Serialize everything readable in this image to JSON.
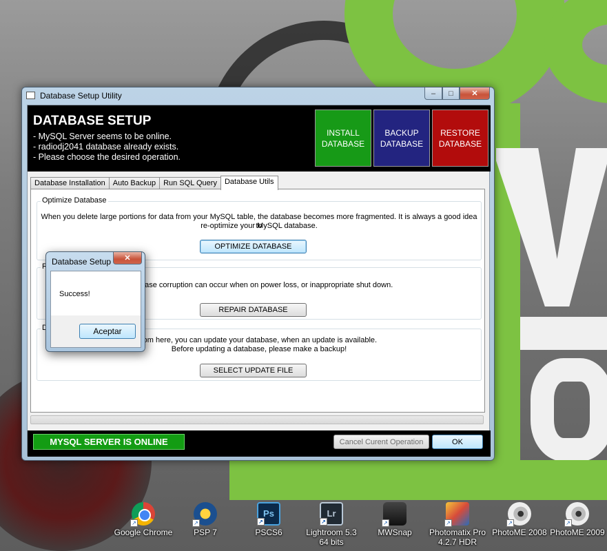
{
  "window": {
    "title": "Database Setup Utility",
    "caption_min": "–",
    "caption_max": "□",
    "caption_close": "✕"
  },
  "header": {
    "title": "DATABASE SETUP",
    "lines": [
      "- MySQL Server seems to be online.",
      "- radiodj2041 database already exists.",
      "- Please choose the desired operation."
    ],
    "buttons": {
      "install": "INSTALL\nDATABASE",
      "backup": "BACKUP\nDATABASE",
      "restore": "RESTORE\nDATABASE"
    }
  },
  "tabs": [
    {
      "label": "Database Installation",
      "active": false
    },
    {
      "label": "Auto Backup",
      "active": false
    },
    {
      "label": "Run SQL Query",
      "active": false
    },
    {
      "label": "Database Utils",
      "active": true
    }
  ],
  "groups": {
    "optimize": {
      "title": "Optimize Database",
      "text1": "When you delete large portions for data from your MySQL table, the database becomes more fragmented. It is always a good idea to",
      "text2": "re-optimize your MySQL database.",
      "button": "OPTIMIZE DATABASE"
    },
    "repair": {
      "title": "R",
      "text1": "base corruption can occur when on power loss, or inappropriate shut down.",
      "button": "REPAIR DATABASE"
    },
    "update": {
      "title": "D",
      "text1": "rom here, you can update your database, when an update is available.",
      "text2": "Before updating a database, please make a backup!",
      "button": "SELECT UPDATE FILE"
    }
  },
  "progress": {
    "value": 0
  },
  "footer": {
    "status": "MYSQL SERVER IS ONLINE",
    "cancel": "Cancel Curent Operation",
    "ok": "OK"
  },
  "dialog": {
    "title": "Database Setup",
    "close": "✕",
    "message": "Success!",
    "ok": "Aceptar"
  },
  "desktop_icons": [
    {
      "label": "Google Chrome",
      "icon": "chrome-icon"
    },
    {
      "label": "PSP 7",
      "icon": "psp-icon"
    },
    {
      "label": "PSCS6",
      "icon": "photoshop-icon",
      "glyph": "Ps"
    },
    {
      "label": "Lightroom 5.3 64 bits",
      "icon": "lightroom-icon",
      "glyph": "Lr"
    },
    {
      "label": "MWSnap",
      "icon": "mwsnap-icon"
    },
    {
      "label": "Photomatix Pro 4.2.7 HDR",
      "icon": "photomatix-icon"
    },
    {
      "label": "PhotoME 2008",
      "icon": "photome-icon"
    },
    {
      "label": "PhotoME 2009",
      "icon": "photome-icon"
    }
  ],
  "colors": {
    "install": "#179a17",
    "backup": "#232480",
    "restore": "#b20c0c",
    "status_online": "#139c13"
  }
}
